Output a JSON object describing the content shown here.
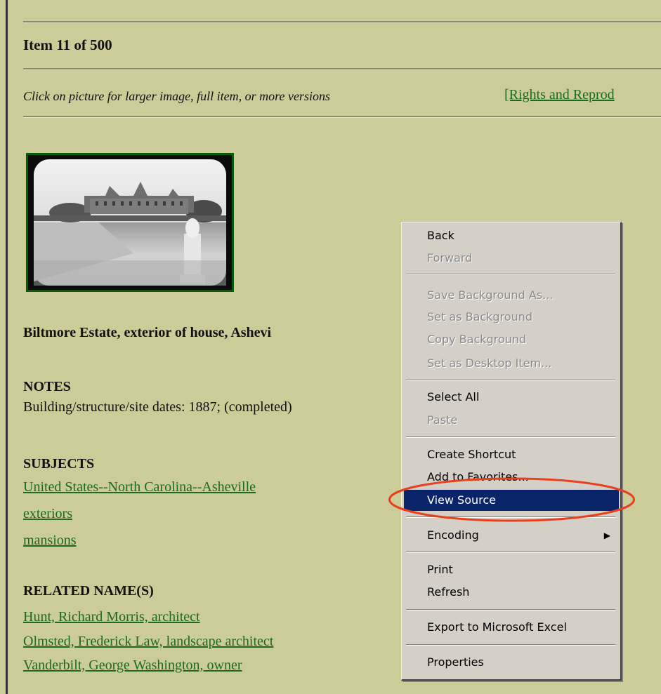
{
  "header": {
    "item_counter": "Item 11 of 500",
    "click_hint": "Click on picture for larger image, full item, or more versions",
    "rights_link": "[Rights and Reprod"
  },
  "item": {
    "title": "Biltmore Estate, exterior of house, Ashevi",
    "notes_heading": "NOTES",
    "notes_text": "Building/structure/site dates: 1887; (completed)",
    "subjects_heading": "SUBJECTS",
    "subjects": [
      "United States--North Carolina--Asheville",
      "exteriors",
      "mansions"
    ],
    "related_heading": "RELATED NAME(S)",
    "related_names": [
      "Hunt, Richard Morris, architect",
      "Olmsted, Frederick Law, landscape architect",
      "Vanderbilt, George Washington, owner"
    ]
  },
  "context_menu": {
    "items": [
      {
        "label": "Back",
        "disabled": false
      },
      {
        "label": "Forward",
        "disabled": true
      },
      {
        "label": "Save Background As...",
        "disabled": true
      },
      {
        "label": "Set as Background",
        "disabled": true
      },
      {
        "label": "Copy Background",
        "disabled": true
      },
      {
        "label": "Set as Desktop Item...",
        "disabled": true
      },
      {
        "label": "Select All",
        "disabled": false
      },
      {
        "label": "Paste",
        "disabled": true
      },
      {
        "label": "Create Shortcut",
        "disabled": false
      },
      {
        "label": "Add to Favorites...",
        "disabled": false
      },
      {
        "label": "View Source",
        "disabled": false,
        "highlighted": true
      },
      {
        "label": "Encoding",
        "disabled": false,
        "submenu": true
      },
      {
        "label": "Print",
        "disabled": false
      },
      {
        "label": "Refresh",
        "disabled": false
      },
      {
        "label": "Export to Microsoft Excel",
        "disabled": false
      },
      {
        "label": "Properties",
        "disabled": false
      }
    ],
    "submenu_arrow": "▶"
  },
  "colors": {
    "page_background": "#cccc99",
    "link_green": "#1b6b1b",
    "menu_background": "#d4d0c8",
    "menu_highlight": "#0a246a",
    "annotation_ring": "#e8401c"
  }
}
